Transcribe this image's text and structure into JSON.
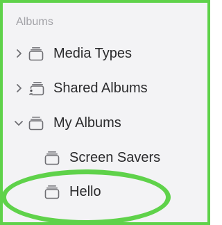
{
  "sidebar": {
    "section_title": "Albums",
    "items": [
      {
        "label": "Media Types",
        "icon": "album-stack-icon",
        "chevron": "chevron-right-icon"
      },
      {
        "label": "Shared Albums",
        "icon": "shared-album-icon",
        "chevron": "chevron-right-icon"
      },
      {
        "label": "My Albums",
        "icon": "album-stack-icon",
        "chevron": "chevron-down-icon"
      },
      {
        "label": "Screen Savers",
        "icon": "album-stack-icon"
      },
      {
        "label": "Hello",
        "icon": "album-stack-icon"
      }
    ]
  },
  "colors": {
    "highlight": "#5fd24a",
    "background": "#f3f3f5",
    "text": "#2a2a2c",
    "section_title": "#a2a2a7"
  }
}
